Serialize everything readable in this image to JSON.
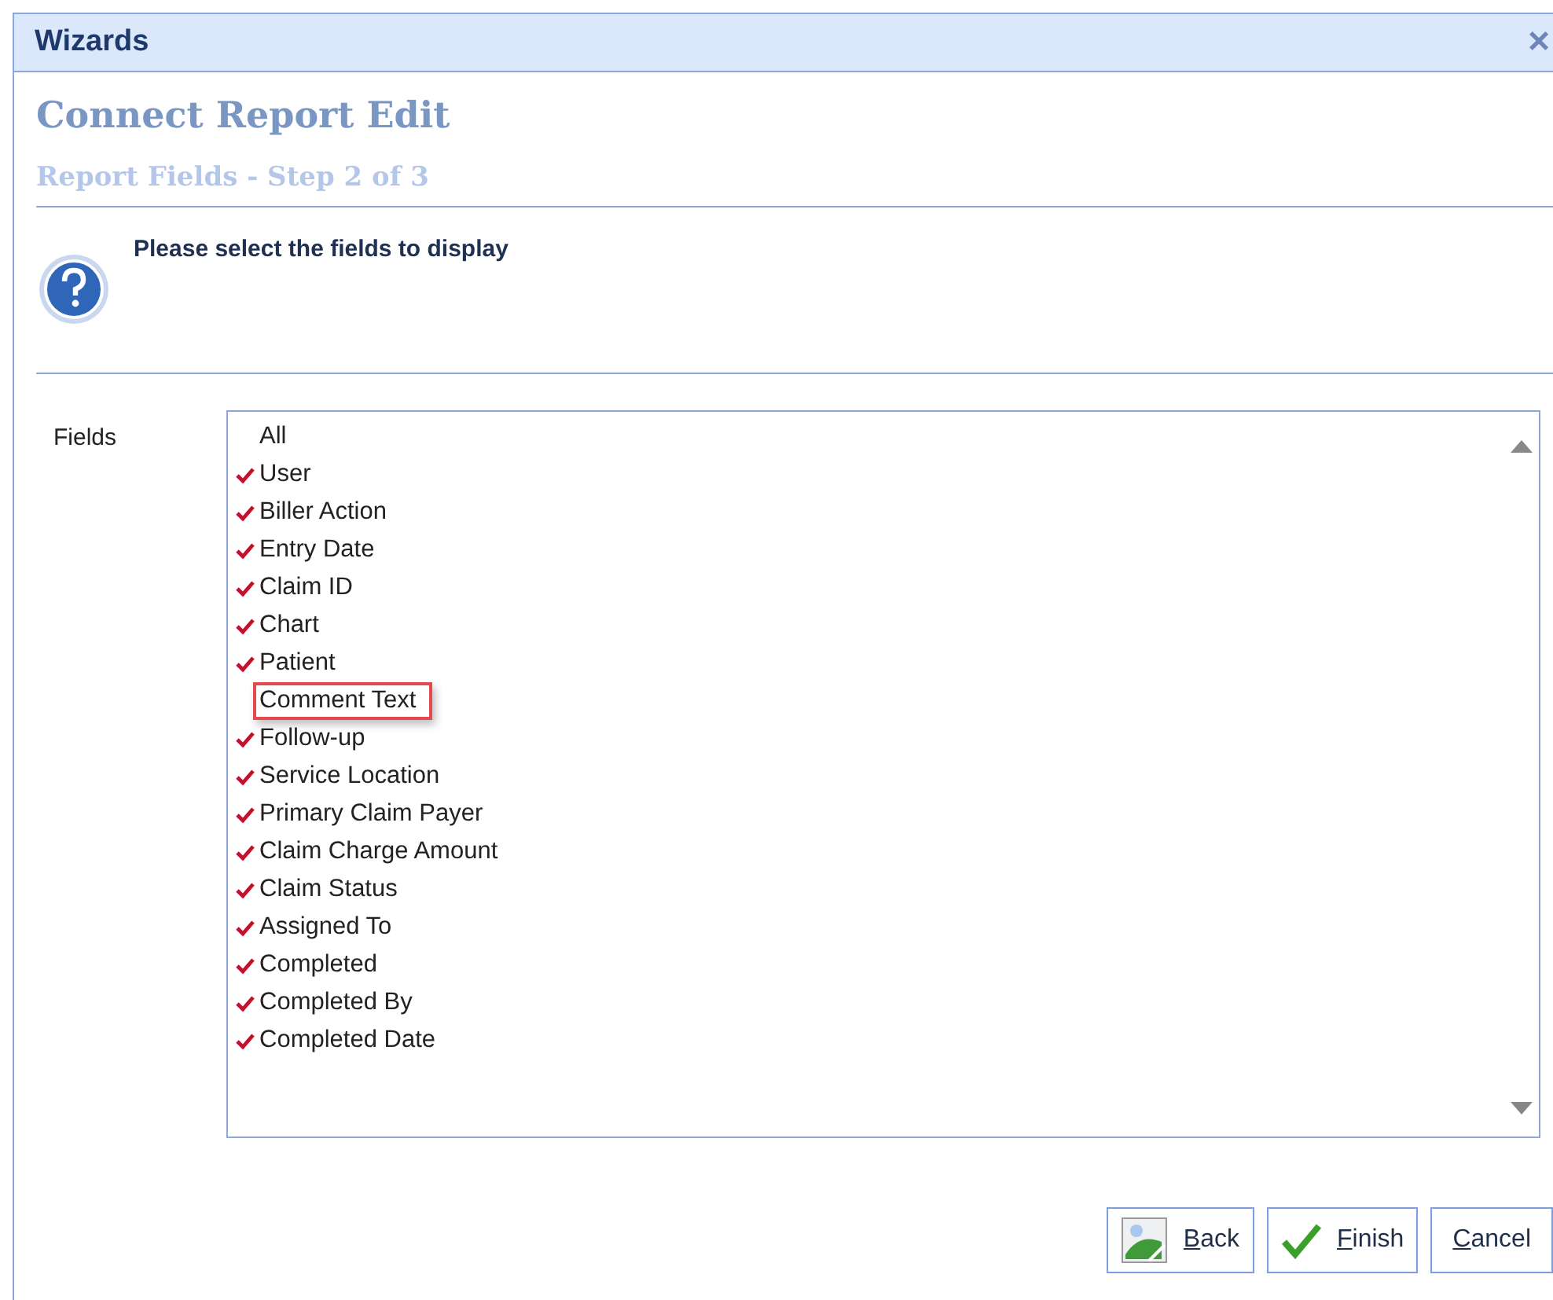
{
  "window": {
    "title": "Wizards",
    "close": "×"
  },
  "heading": "Connect Report Edit",
  "step": "Report Fields - Step 2 of 3",
  "instruction": "Please select the fields to display",
  "fields": {
    "label": "Fields",
    "items": [
      {
        "label": "All",
        "checked": false,
        "highlighted": false
      },
      {
        "label": "User",
        "checked": true,
        "highlighted": false
      },
      {
        "label": "Biller Action",
        "checked": true,
        "highlighted": false
      },
      {
        "label": "Entry Date",
        "checked": true,
        "highlighted": false
      },
      {
        "label": "Claim ID",
        "checked": true,
        "highlighted": false
      },
      {
        "label": "Chart",
        "checked": true,
        "highlighted": false
      },
      {
        "label": "Patient",
        "checked": true,
        "highlighted": false
      },
      {
        "label": "Comment Text",
        "checked": false,
        "highlighted": true
      },
      {
        "label": "Follow-up",
        "checked": true,
        "highlighted": false
      },
      {
        "label": "Service Location",
        "checked": true,
        "highlighted": false
      },
      {
        "label": "Primary Claim Payer",
        "checked": true,
        "highlighted": false
      },
      {
        "label": "Claim Charge Amount",
        "checked": true,
        "highlighted": false
      },
      {
        "label": "Claim Status",
        "checked": true,
        "highlighted": false
      },
      {
        "label": "Assigned To",
        "checked": true,
        "highlighted": false
      },
      {
        "label": "Completed",
        "checked": true,
        "highlighted": false
      },
      {
        "label": "Completed By",
        "checked": true,
        "highlighted": false
      },
      {
        "label": "Completed Date",
        "checked": true,
        "highlighted": false
      }
    ]
  },
  "buttons": [
    {
      "label": "Back",
      "kind": "back"
    },
    {
      "label": "Finish",
      "kind": "finish"
    },
    {
      "label": "Cancel",
      "kind": "cancel"
    }
  ]
}
